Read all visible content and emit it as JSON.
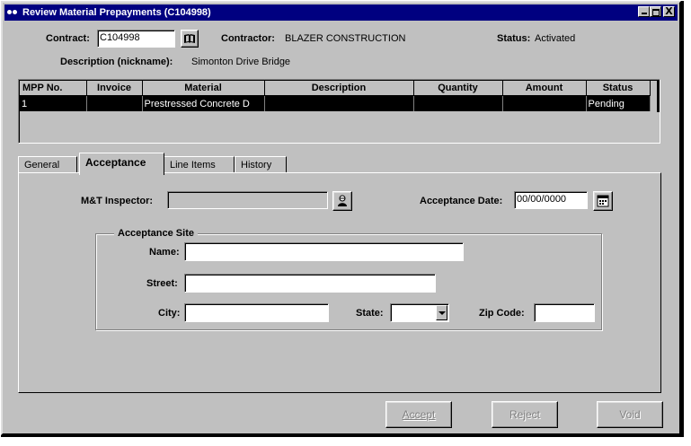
{
  "window": {
    "title": "Review Material Prepayments (C104998)",
    "close_label": "X"
  },
  "header": {
    "contract_label": "Contract:",
    "contract_value": "C104998",
    "contractor_label": "Contractor:",
    "contractor_value": "BLAZER CONSTRUCTION",
    "status_label": "Status:",
    "status_value": "Activated",
    "description_label": "Description (nickname):",
    "description_value": "Simonton Drive Bridge"
  },
  "grid": {
    "columns": [
      "MPP No.",
      "Invoice",
      "Material",
      "Description",
      "Quantity",
      "Amount",
      "Status"
    ],
    "rows": [
      [
        "1",
        "",
        "Prestressed Concrete D",
        "",
        "",
        "",
        "Pending"
      ]
    ]
  },
  "tabs": [
    {
      "label": "General",
      "active": false
    },
    {
      "label": "Acceptance",
      "active": true
    },
    {
      "label": "Line Items",
      "active": false
    },
    {
      "label": "History",
      "active": false
    }
  ],
  "acceptance": {
    "inspector_label": "M&T Inspector:",
    "inspector_value": "",
    "date_label": "Acceptance Date:",
    "date_value": "00/00/0000",
    "site_legend": "Acceptance Site",
    "name_label": "Name:",
    "name_value": "",
    "street_label": "Street:",
    "street_value": "",
    "city_label": "City:",
    "city_value": "",
    "state_label": "State:",
    "state_value": "",
    "zip_label": "Zip Code:",
    "zip_value": ""
  },
  "actions": {
    "accept_label": "Accept",
    "reject_label": "Reject",
    "void_label": "Void"
  },
  "icons": {
    "contract_lookup": "book-icon",
    "inspector_lookup": "person-search-icon",
    "date_picker": "calendar-icon"
  }
}
